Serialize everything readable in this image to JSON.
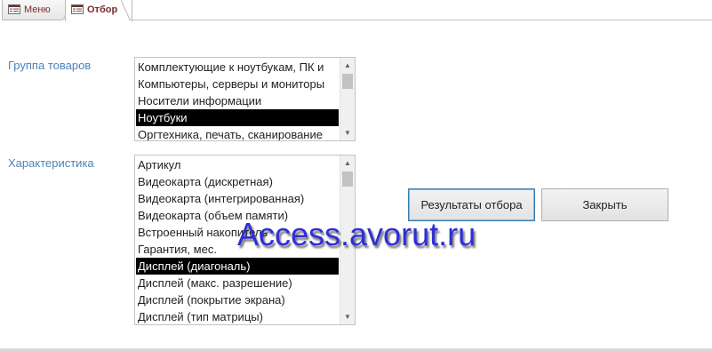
{
  "tabs": [
    {
      "label": "Меню",
      "active": false,
      "icon": "form-icon"
    },
    {
      "label": "Отбор",
      "active": true,
      "icon": "form-icon"
    }
  ],
  "group": {
    "label": "Группа товаров",
    "items": [
      "Комплектующие к ноутбукам, ПК и",
      "Компьютеры, серверы и мониторы",
      "Носители информации",
      "Ноутбуки",
      "Оргтехника, печать, сканирование"
    ],
    "selected": "Ноутбуки"
  },
  "characteristic": {
    "label": "Характеристика",
    "items": [
      "Артикул",
      "Видеокарта (дискретная)",
      "Видеокарта (интегрированная)",
      "Видеокарта (объем памяти)",
      "Встроенный накопитель",
      "Гарантия, мес.",
      "Дисплей (диагональ)",
      "Дисплей (макс. разрешение)",
      "Дисплей (покрытие экрана)",
      "Дисплей (тип матрицы)"
    ],
    "selected": "Дисплей (диагональ)"
  },
  "buttons": {
    "results": "Результаты отбора",
    "close": "Закрыть"
  },
  "watermark": "Access.avorut.ru",
  "colors": {
    "label": "#4f81bd",
    "selection": "#000000",
    "watermark": "#2e2ed8"
  }
}
